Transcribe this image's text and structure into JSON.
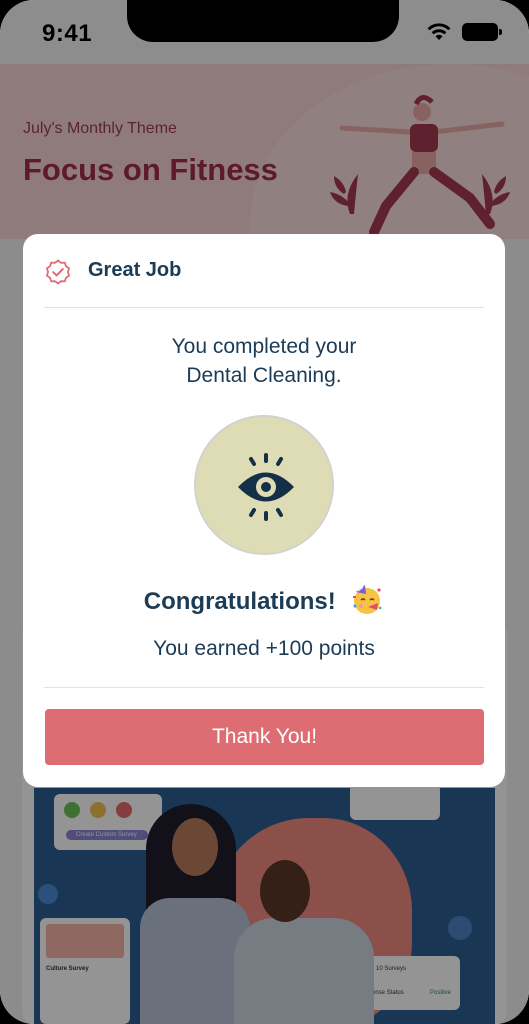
{
  "status_bar": {
    "time": "9:41"
  },
  "banner": {
    "subtitle": "July's Monthly Theme",
    "title": "Focus on Fitness"
  },
  "background_cards": {
    "survey_button": "Create Custom Survey",
    "culture_survey": "Culture Survey",
    "surveys_count": "10 Surveys",
    "response_status": "Response Status",
    "positive": "Positive"
  },
  "modal": {
    "title": "Great Job",
    "message_line1": "You completed your",
    "message_line2": "Dental Cleaning.",
    "congrats": "Congratulations!",
    "points": "You earned +100 points",
    "button": "Thank You!"
  },
  "colors": {
    "accent": "#dd6c73",
    "title_text": "#1c3b55",
    "banner_bg": "#f6d5d5",
    "banner_title": "#a32e45",
    "icon_circle": "#dedcb4"
  },
  "icons": {
    "badge": "badge-check-icon",
    "activity": "eye-icon",
    "celebration": "party-face-icon"
  }
}
